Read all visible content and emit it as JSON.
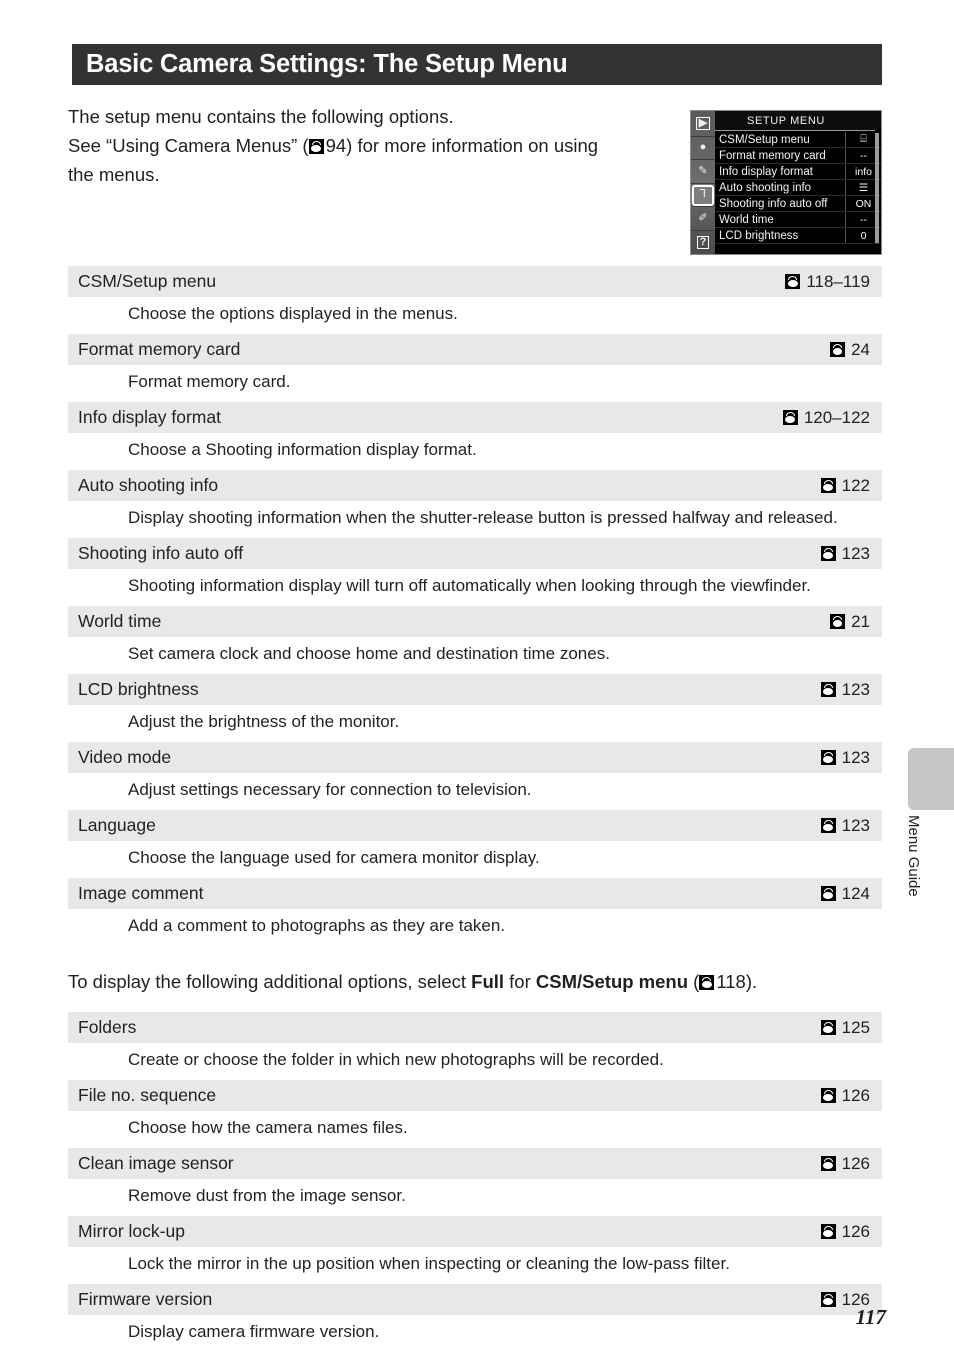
{
  "header": {
    "title": "Basic Camera Settings: The Setup Menu"
  },
  "intro": {
    "line1": "The setup menu contains the following options.",
    "line2_before": "See “Using Camera Menus” (",
    "line2_page": "94) for more information on using",
    "line3": "the menus."
  },
  "lcd": {
    "title": "SETUP MENU",
    "sidebar_icons": [
      {
        "name": "playback-icon",
        "glyph": "▶"
      },
      {
        "name": "shooting-menu-icon",
        "glyph": "●"
      },
      {
        "name": "custom-settings-icon",
        "glyph": "✎"
      },
      {
        "name": "setup-menu-icon",
        "glyph": "⑂"
      },
      {
        "name": "retouch-menu-icon",
        "glyph": "✐"
      },
      {
        "name": "recent-settings-icon",
        "glyph": "?"
      }
    ],
    "rows": [
      {
        "label": "CSM/Setup menu",
        "value": "⌸"
      },
      {
        "label": "Format memory card",
        "value": "--"
      },
      {
        "label": "Info display format",
        "value": "info"
      },
      {
        "label": "Auto shooting info",
        "value": "☰"
      },
      {
        "label": "Shooting info auto off",
        "value": "ON"
      },
      {
        "label": "World time",
        "value": "--"
      },
      {
        "label": "LCD brightness",
        "value": "0"
      }
    ]
  },
  "options_primary": [
    {
      "name": "CSM/Setup menu",
      "page": "118–119",
      "desc": "Choose the options displayed in the menus."
    },
    {
      "name": "Format memory card",
      "page": "24",
      "desc": "Format memory card."
    },
    {
      "name": "Info display format",
      "page": "120–122",
      "desc": "Choose a Shooting information display format."
    },
    {
      "name": "Auto shooting info",
      "page": "122",
      "desc": "Display shooting information when the shutter-release button is pressed halfway and released."
    },
    {
      "name": "Shooting info auto off",
      "page": "123",
      "desc": "Shooting information display will turn off automatically when looking through the viewfinder."
    },
    {
      "name": "World time",
      "page": "21",
      "desc": "Set camera clock and choose home and destination time zones."
    },
    {
      "name": "LCD brightness",
      "page": "123",
      "desc": "Adjust the brightness of the monitor."
    },
    {
      "name": "Video mode",
      "page": "123",
      "desc": "Adjust settings necessary for connection to television."
    },
    {
      "name": "Language",
      "page": "123",
      "desc": "Choose the language used for camera monitor display."
    },
    {
      "name": "Image comment",
      "page": "124",
      "desc": "Add a comment to photographs as they are taken."
    }
  ],
  "mid_paragraph": {
    "part1": "To display the following additional options, select ",
    "bold1": "Full",
    "part2": " for ",
    "bold2": "CSM/Setup menu",
    "part3": " (",
    "page": "118)."
  },
  "options_secondary": [
    {
      "name": "Folders",
      "page": "125",
      "desc": "Create or choose the folder in which new photographs will be recorded."
    },
    {
      "name": "File no. sequence",
      "page": "126",
      "desc": "Choose how the camera names files."
    },
    {
      "name": "Clean image sensor",
      "page": "126",
      "desc": "Remove dust from the image sensor."
    },
    {
      "name": "Mirror lock-up",
      "page": "126",
      "desc": "Lock the mirror in the up position when inspecting or cleaning the low-pass filter."
    },
    {
      "name": "Firmware version",
      "page": "126",
      "desc": "Display camera firmware version."
    }
  ],
  "side_tab": {
    "label": "Menu Guide"
  },
  "page_number": "117",
  "colors": {
    "banner_bg": "#333333",
    "row_bg": "#e8e8e8",
    "text": "#231f20",
    "tab_bg": "#c6c6c6"
  }
}
